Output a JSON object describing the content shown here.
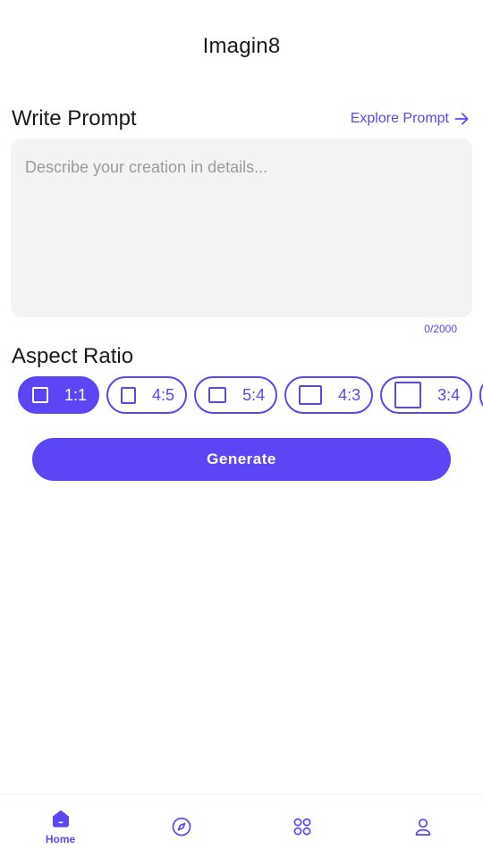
{
  "app": {
    "title": "Imagin8"
  },
  "prompt": {
    "section_title": "Write Prompt",
    "explore_label": "Explore Prompt",
    "placeholder": "Describe your creation in details...",
    "value": "",
    "counter": "0/2000"
  },
  "aspect_ratio": {
    "section_title": "Aspect Ratio",
    "options": [
      {
        "label": "1:1",
        "selected": true
      },
      {
        "label": "4:5",
        "selected": false
      },
      {
        "label": "5:4",
        "selected": false
      },
      {
        "label": "4:3",
        "selected": false
      },
      {
        "label": "3:4",
        "selected": false
      }
    ]
  },
  "generate": {
    "label": "Generate"
  },
  "bottom_nav": {
    "items": [
      {
        "label": "Home",
        "icon": "home-icon",
        "active": true
      },
      {
        "label": "",
        "icon": "compass-icon",
        "active": false
      },
      {
        "label": "",
        "icon": "grid-icon",
        "active": false
      },
      {
        "label": "",
        "icon": "profile-icon",
        "active": false
      }
    ]
  },
  "colors": {
    "accent": "#5b45f5",
    "input_bg": "#f3f3f3",
    "placeholder": "#9b9b9b"
  }
}
